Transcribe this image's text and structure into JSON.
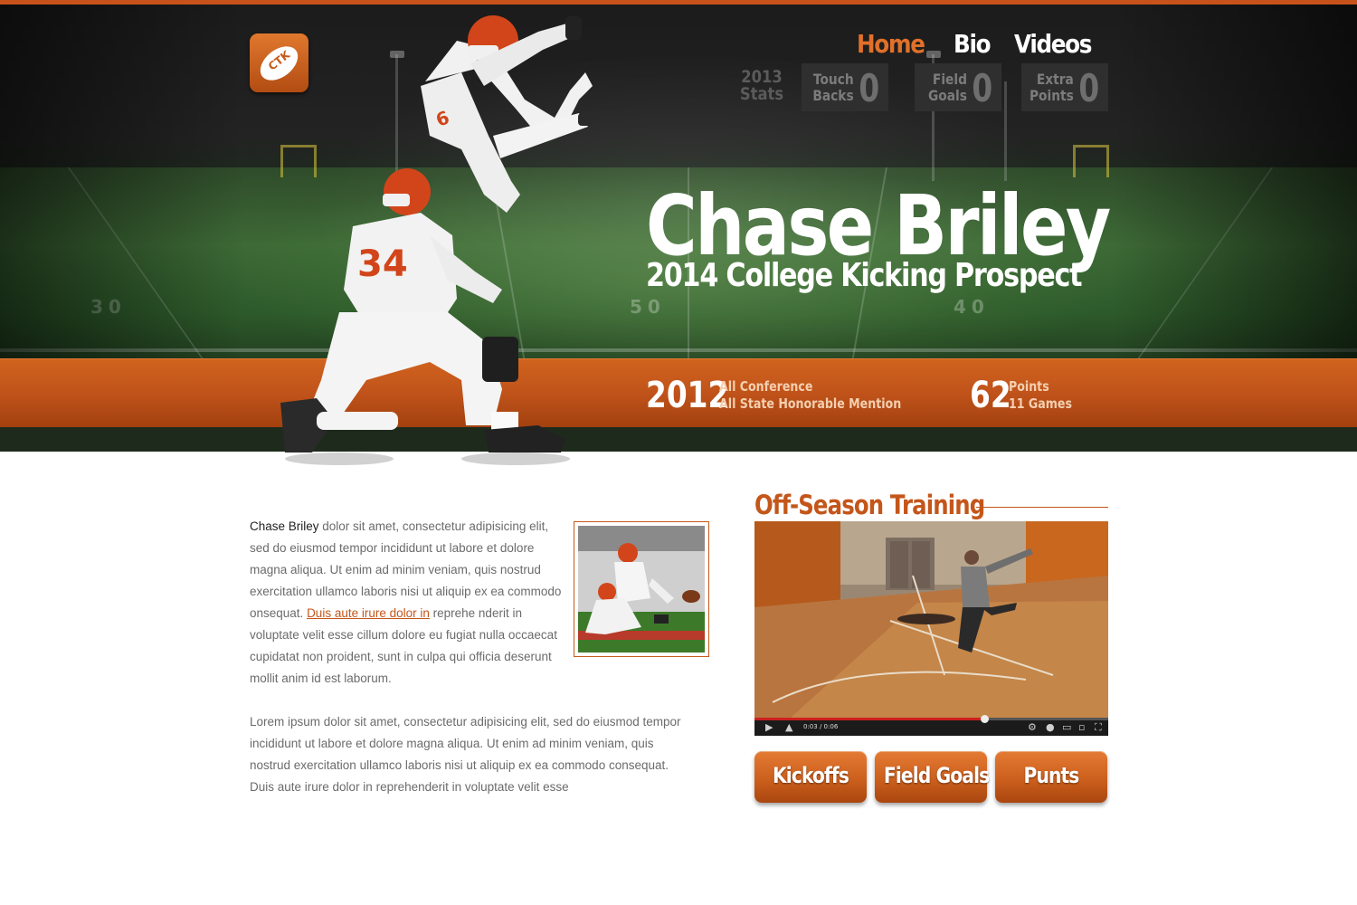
{
  "brand": {
    "logo_text": "CTK"
  },
  "nav": {
    "items": [
      {
        "label": "Home",
        "active": true
      },
      {
        "label": "Bio"
      },
      {
        "label": "Videos"
      }
    ]
  },
  "stats": {
    "label_line1": "2013",
    "label_line2": "Stats",
    "items": [
      {
        "line1": "Touch",
        "line2": "Backs",
        "value": "0"
      },
      {
        "line1": "Field",
        "line2": "Goals",
        "value": "0"
      },
      {
        "line1": "Extra",
        "line2": "Points",
        "value": "0"
      }
    ]
  },
  "hero": {
    "title": "Chase Briley",
    "subtitle": "2014 College Kicking Prospect",
    "field_numbers": [
      "30",
      "50",
      "40"
    ]
  },
  "awards": {
    "year": "2012",
    "line1": "All Conference",
    "line2": "All State Honorable Mention",
    "points_value": "62",
    "points_line1": "Points",
    "points_line2": "11 Games"
  },
  "bio": {
    "name": "Chase Briley",
    "text_before_link": " dolor sit amet, consectetur adipisicing elit, sed do eiusmod tempor incididunt ut labore et dolore magna aliqua. Ut enim ad minim veniam, quis nostrud exercitation ullamco laboris nisi ut aliquip ex ea commodo onsequat. ",
    "link_text": "Duis aute irure dolor in",
    "text_after_link": " reprehe nderit in voluptate velit esse cillum dolore eu fugiat nulla occaecat cupidatat non proident, sunt in culpa qui officia deserunt mollit anim id est laborum.",
    "paragraph2": "Lorem ipsum dolor sit amet, consectetur adipisicing elit, sed do eiusmod tempor incididunt ut labore et dolore magna aliqua. Ut enim ad minim veniam, quis nostrud exercitation ullamco laboris nisi ut aliquip ex ea commodo consequat. Duis aute irure dolor in reprehenderit in voluptate velit esse"
  },
  "training": {
    "title": "Off-Season Training",
    "video": {
      "current_time": "0:03",
      "duration": "0:06",
      "progress": 0.65
    }
  },
  "buttons": [
    {
      "label": "Kickoffs"
    },
    {
      "label": "Field Goals"
    },
    {
      "label": "Punts"
    }
  ],
  "colors": {
    "accent": "#c4561a",
    "band": "#c0531a",
    "hero_dark": "#1b1b1b",
    "field_green": "#3d6a36"
  }
}
